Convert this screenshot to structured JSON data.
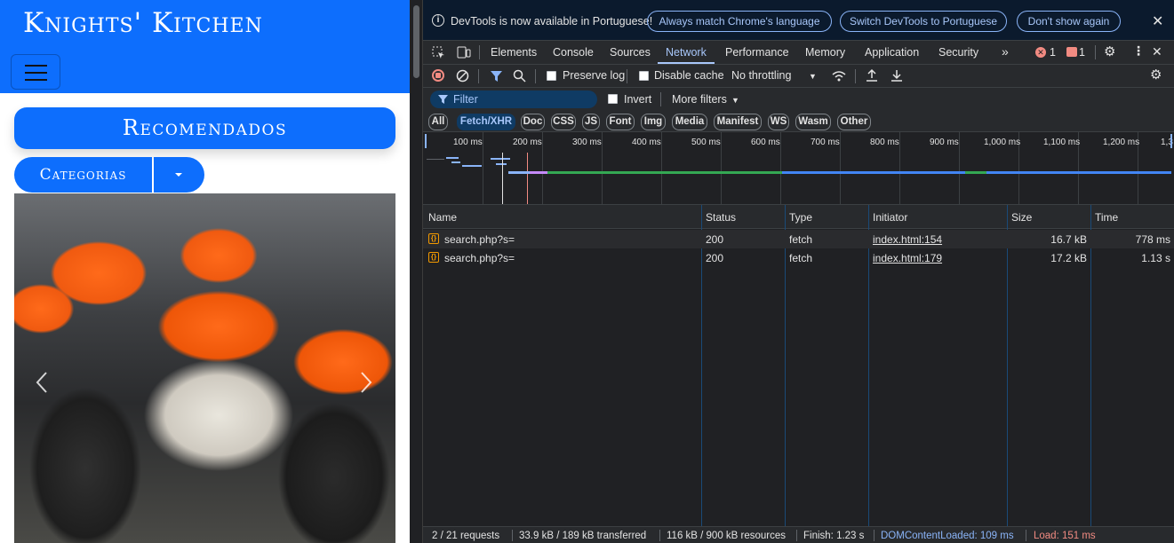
{
  "site": {
    "brand": "Knights' Kitchen",
    "recommended_label": "Recomendados",
    "categories_label": "Categorias"
  },
  "devtools": {
    "infobar": {
      "message": "DevTools is now available in Portuguese!",
      "match_language": "Always match Chrome's language",
      "switch_language": "Switch DevTools to Portuguese",
      "dont_show": "Don't show again"
    },
    "tabs": [
      "Elements",
      "Console",
      "Sources",
      "Network",
      "Performance",
      "Memory",
      "Application",
      "Security"
    ],
    "active_tab": "Network",
    "error_count": "1",
    "issue_count": "1",
    "toolbar": {
      "preserve_log": "Preserve log",
      "disable_cache": "Disable cache",
      "throttling": "No throttling"
    },
    "filter": {
      "placeholder": "Filter",
      "invert": "Invert",
      "more_filters": "More filters"
    },
    "type_filters": [
      "All",
      "Fetch/XHR",
      "Doc",
      "CSS",
      "JS",
      "Font",
      "Img",
      "Media",
      "Manifest",
      "WS",
      "Wasm",
      "Other"
    ],
    "active_type_filter": "Fetch/XHR",
    "timeline_ticks": [
      "100 ms",
      "200 ms",
      "300 ms",
      "400 ms",
      "500 ms",
      "600 ms",
      "700 ms",
      "800 ms",
      "900 ms",
      "1,000 ms",
      "1,100 ms",
      "1,200 ms",
      "1,3"
    ],
    "columns": [
      "Name",
      "Status",
      "Type",
      "Initiator",
      "Size",
      "Time"
    ],
    "requests": [
      {
        "name": "search.php?s=",
        "status": "200",
        "type": "fetch",
        "initiator": "index.html:154",
        "size": "16.7 kB",
        "time": "778 ms"
      },
      {
        "name": "search.php?s=",
        "status": "200",
        "type": "fetch",
        "initiator": "index.html:179",
        "size": "17.2 kB",
        "time": "1.13 s"
      }
    ],
    "summary": {
      "requests": "2 / 21 requests",
      "transferred": "33.9 kB / 189 kB transferred",
      "resources": "116 kB / 900 kB resources",
      "finish": "Finish: 1.23 s",
      "dom_content_loaded": "DOMContentLoaded: 109 ms",
      "load": "Load: 151 ms"
    }
  },
  "colors": {
    "site_primary": "#0d6efd",
    "devtools_bg": "#202124",
    "accent": "#a8c7fa"
  }
}
